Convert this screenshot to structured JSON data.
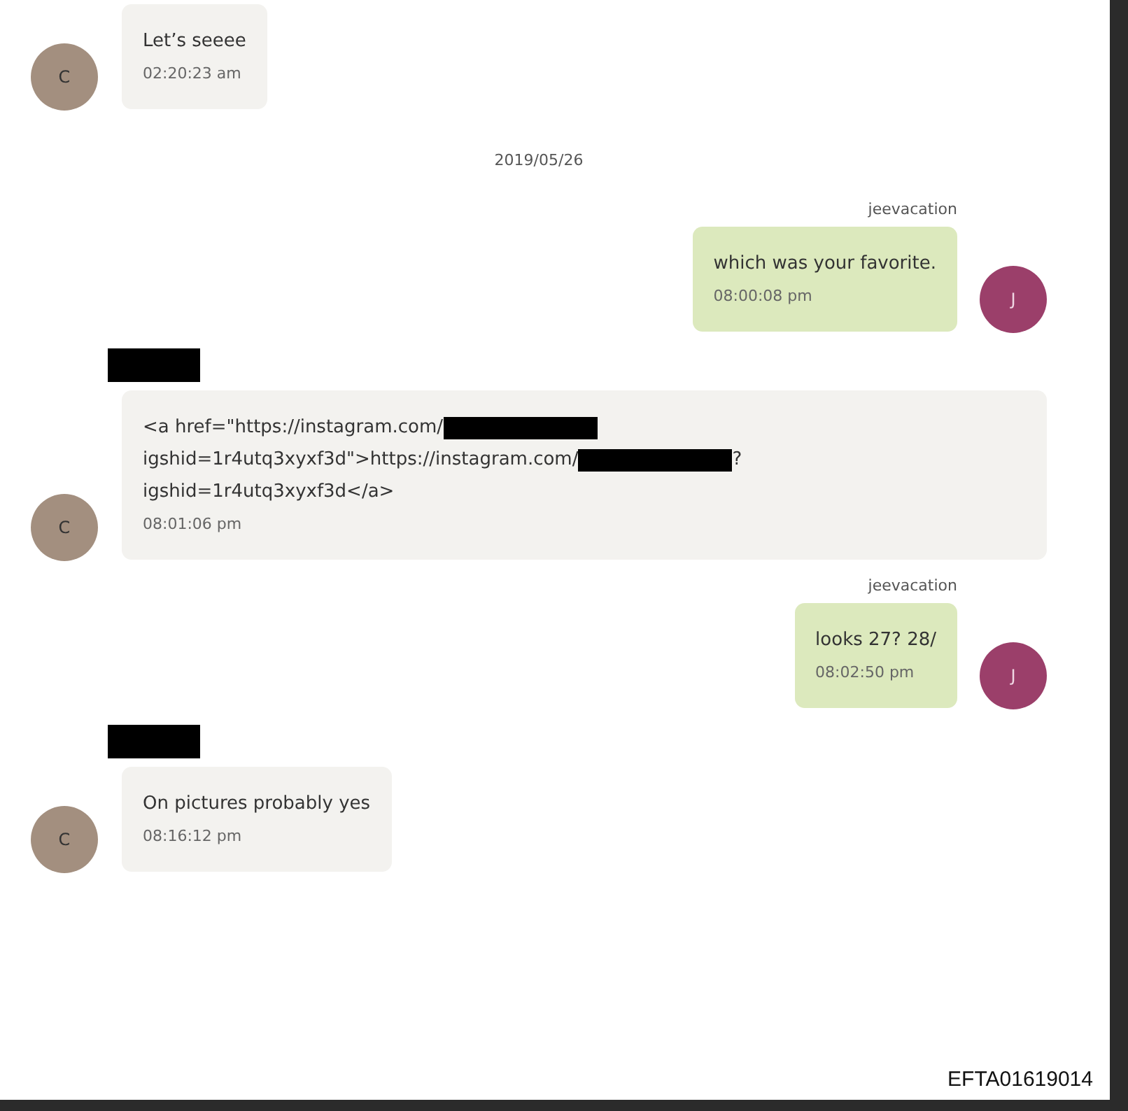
{
  "messages": [
    {
      "kind": "message",
      "outgoing": false,
      "avatar": "C",
      "lines": [
        [
          {
            "kind": "text",
            "text": "Let’s seeee"
          }
        ]
      ],
      "time": "02:20:23 am"
    },
    {
      "kind": "date",
      "text": "2019/05/26"
    },
    {
      "kind": "message",
      "outgoing": true,
      "sender": {
        "kind": "name",
        "text": "jeevacation"
      },
      "avatar": "J",
      "lines": [
        [
          {
            "kind": "text",
            "text": "which was your favorite."
          }
        ]
      ],
      "time": "08:00:08 pm"
    },
    {
      "kind": "message",
      "outgoing": false,
      "sender": {
        "kind": "redaction"
      },
      "avatar": "C",
      "lines": [
        [
          {
            "kind": "text",
            "text": "<a href=\"https://instagram.com/"
          },
          {
            "kind": "redaction"
          }
        ],
        [
          {
            "kind": "text",
            "text": "igshid=1r4utq3xyxf3d\">https://instagram.com/"
          },
          {
            "kind": "redaction"
          },
          {
            "kind": "text",
            "text": "?"
          }
        ],
        [
          {
            "kind": "text",
            "text": "igshid=1r4utq3xyxf3d</a>"
          }
        ]
      ],
      "time": "08:01:06 pm"
    },
    {
      "kind": "message",
      "outgoing": true,
      "sender": {
        "kind": "name",
        "text": "jeevacation"
      },
      "avatar": "J",
      "lines": [
        [
          {
            "kind": "text",
            "text": "looks 27? 28/"
          }
        ]
      ],
      "time": "08:02:50 pm"
    },
    {
      "kind": "message",
      "outgoing": false,
      "sender": {
        "kind": "redaction"
      },
      "avatar": "C",
      "lines": [
        [
          {
            "kind": "text",
            "text": "On pictures probably yes"
          }
        ]
      ],
      "time": "08:16:12 pm"
    }
  ],
  "footer": {
    "doc_id": "EFTA01619014"
  }
}
